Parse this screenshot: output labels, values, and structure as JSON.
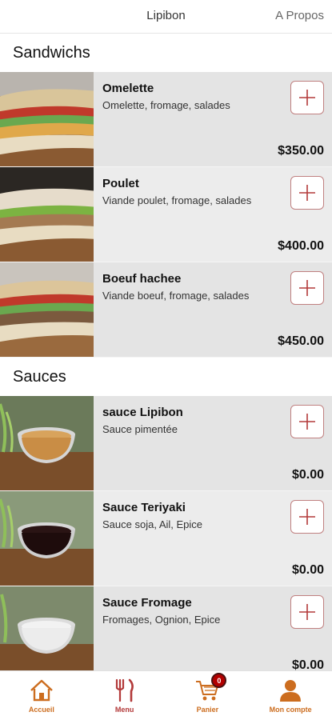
{
  "header": {
    "title": "Lipibon",
    "about": "A Propos"
  },
  "sections": [
    {
      "title": "Sandwichs",
      "items": [
        {
          "name": "Omelette",
          "desc": "Omelette, fromage, salades",
          "price": "$350.00",
          "image": "sandwich-omelette"
        },
        {
          "name": "Poulet",
          "desc": "Viande poulet, fromage, salades",
          "price": "$400.00",
          "image": "sandwich-poulet"
        },
        {
          "name": "Boeuf hachee",
          "desc": "Viande boeuf, fromage, salades",
          "price": "$450.00",
          "image": "sandwich-boeuf"
        }
      ]
    },
    {
      "title": "Sauces",
      "items": [
        {
          "name": "sauce Lipibon",
          "desc": "Sauce pimentée",
          "price": "$0.00",
          "image": "sauce-bowl-orange"
        },
        {
          "name": "Sauce Teriyaki",
          "desc": "Sauce soja, Ail, Epice",
          "price": "$0.00",
          "image": "sauce-bowl-dark"
        },
        {
          "name": "Sauce Fromage",
          "desc": "Fromages, Ognion, Epice",
          "price": "$0.00",
          "image": "sauce-bowl-white"
        }
      ]
    }
  ],
  "nav": {
    "home": {
      "label": "Accueil",
      "icon": "home-icon"
    },
    "menu": {
      "label": "Menu",
      "icon": "fork-knife-icon"
    },
    "cart": {
      "label": "Panier",
      "icon": "cart-icon",
      "badge": "0"
    },
    "account": {
      "label": "Mon compte",
      "icon": "user-icon"
    }
  },
  "colors": {
    "accent": "#cc6d1f",
    "menu_active": "#b33a3a",
    "add_button_border": "#c08080",
    "add_plus": "#b33a3a",
    "badge": "#b30000"
  }
}
